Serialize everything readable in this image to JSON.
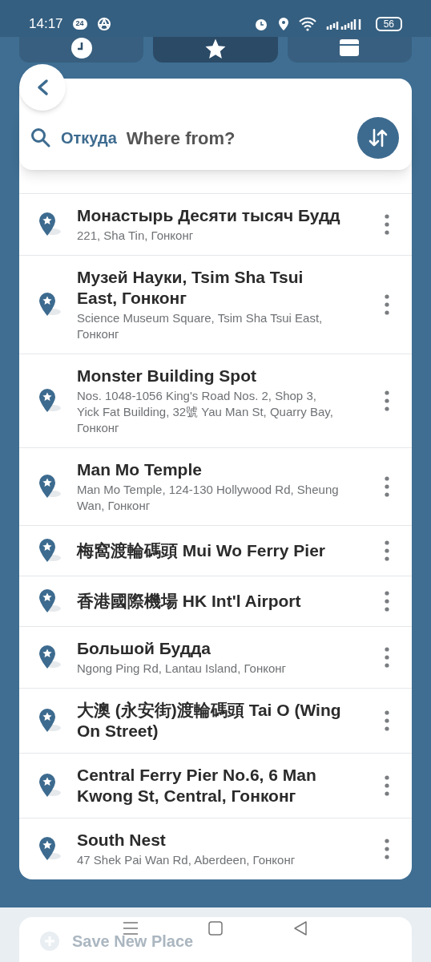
{
  "status_bar": {
    "time": "14:17",
    "notification_badge": "24",
    "battery": "56"
  },
  "tabs": [
    {
      "kind": "clock",
      "selected": false
    },
    {
      "kind": "star",
      "selected": true
    },
    {
      "kind": "calendar",
      "selected": false
    }
  ],
  "search": {
    "label": "Откуда",
    "placeholder": "Where from?"
  },
  "places": [
    {
      "title": "Монастырь Десяти тысяч Будд",
      "address": "221, Sha Tin, Гонконг"
    },
    {
      "title": "Музей Науки, Tsim Sha Tsui East, Гонконг",
      "address": "Science Museum Square, Tsim Sha Tsui East, Гонконг"
    },
    {
      "title": "Monster Building Spot",
      "address": "Nos. 1048-1056 King's Road Nos. 2, Shop 3, Yick Fat Building, 32號 Yau Man St, Quarry Bay, Гонконг"
    },
    {
      "title": "Man Mo Temple",
      "address": "Man Mo Temple, 124-130 Hollywood Rd, Sheung Wan, Гонконг"
    },
    {
      "title": "梅窩渡輪碼頭 Mui Wo Ferry Pier"
    },
    {
      "title": "香港國際機場 HK Int'l Airport"
    },
    {
      "title": "Большой Будда",
      "address": "Ngong Ping Rd, Lantau Island, Гонконг"
    },
    {
      "title": "大澳 (永安街)渡輪碼頭 Tai O (Wing On Street)"
    },
    {
      "title": "Central Ferry Pier No.6, 6 Man Kwong St, Central, Гонконг"
    },
    {
      "title": "South Nest",
      "address": "47 Shek Pai Wan Rd, Aberdeen, Гонконг"
    }
  ],
  "save_button": {
    "label": "Save New Place"
  }
}
